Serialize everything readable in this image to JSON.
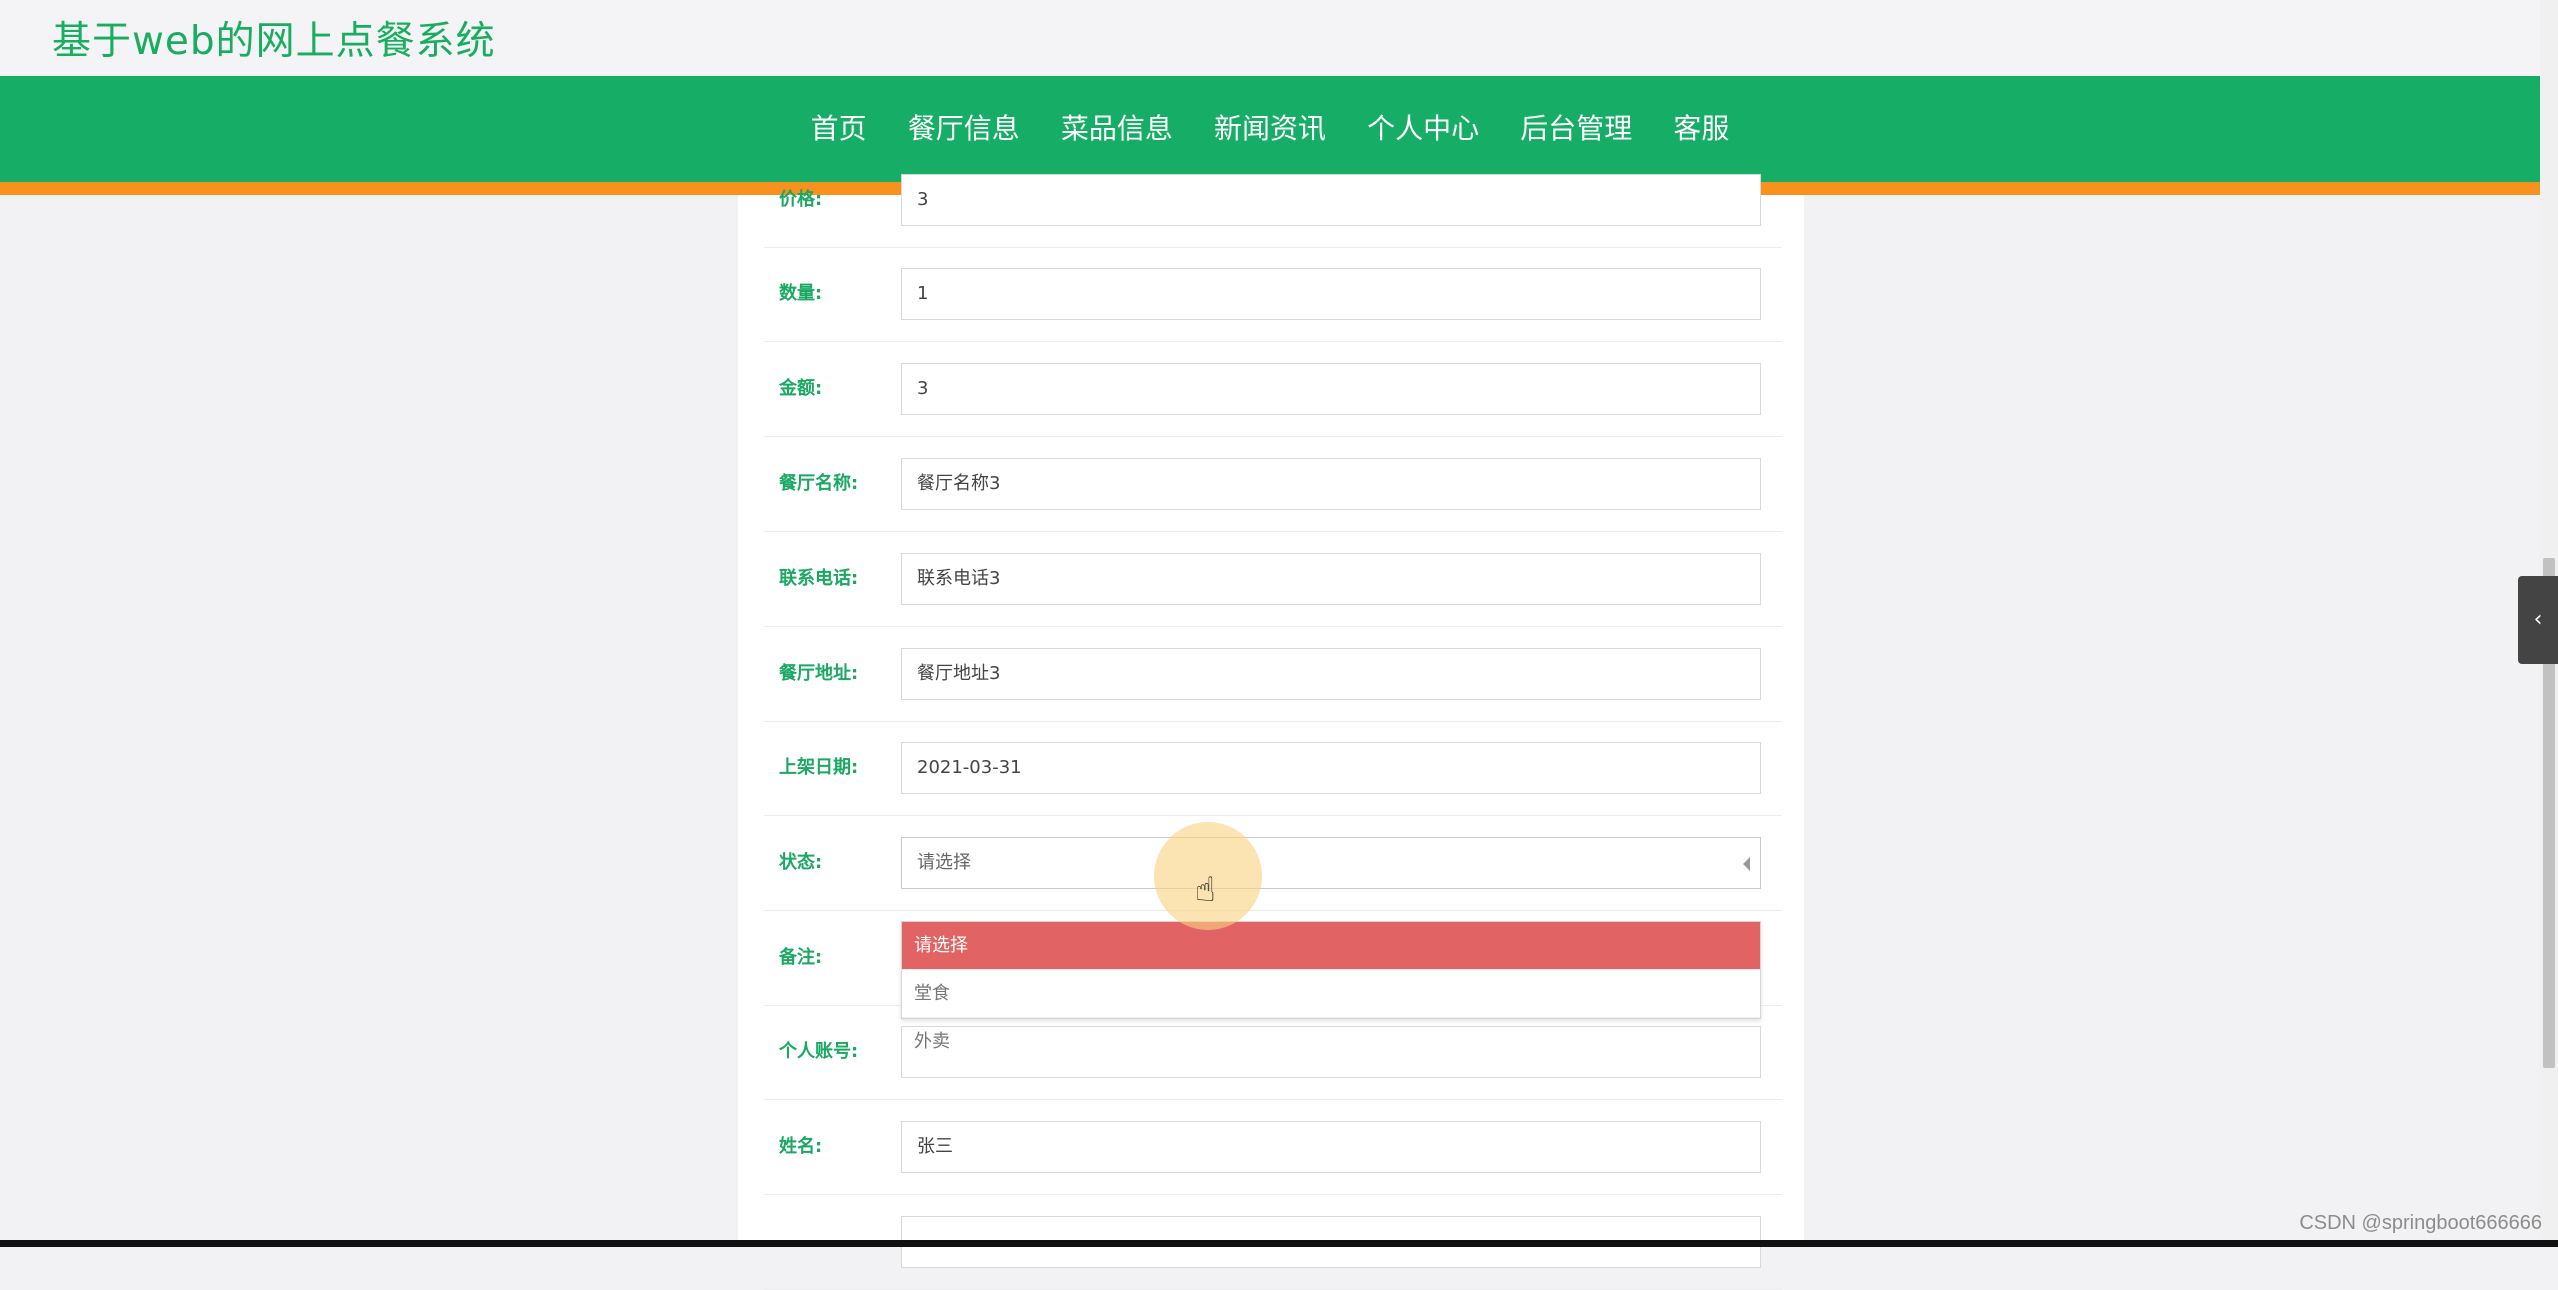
{
  "header": {
    "site_title": "基于web的网上点餐系统"
  },
  "nav": {
    "items": [
      {
        "label": "首页"
      },
      {
        "label": "餐厅信息"
      },
      {
        "label": "菜品信息"
      },
      {
        "label": "新闻资讯"
      },
      {
        "label": "个人中心"
      },
      {
        "label": "后台管理"
      },
      {
        "label": "客服"
      }
    ]
  },
  "form": {
    "price": {
      "label": "价格:",
      "value": "3"
    },
    "quantity": {
      "label": "数量:",
      "value": "1"
    },
    "amount": {
      "label": "金额:",
      "value": "3"
    },
    "restaurant_name": {
      "label": "餐厅名称:",
      "value": "餐厅名称3"
    },
    "phone": {
      "label": "联系电话:",
      "value": "联系电话3"
    },
    "address": {
      "label": "餐厅地址:",
      "value": "餐厅地址3"
    },
    "listing_date": {
      "label": "上架日期:",
      "value": "2021-03-31"
    },
    "status": {
      "label": "状态:",
      "value": "请选择",
      "options": [
        "请选择",
        "堂食",
        "外卖"
      ]
    },
    "remark": {
      "label": "备注:",
      "value": ""
    },
    "account": {
      "label": "个人账号:",
      "value": ""
    },
    "name": {
      "label": "姓名:",
      "value": "张三"
    }
  },
  "watermark": "CSDN @springboot666666",
  "colors": {
    "brand_green": "#16ad66",
    "accent_orange": "#f7921e",
    "selected_option": "#e26363"
  }
}
